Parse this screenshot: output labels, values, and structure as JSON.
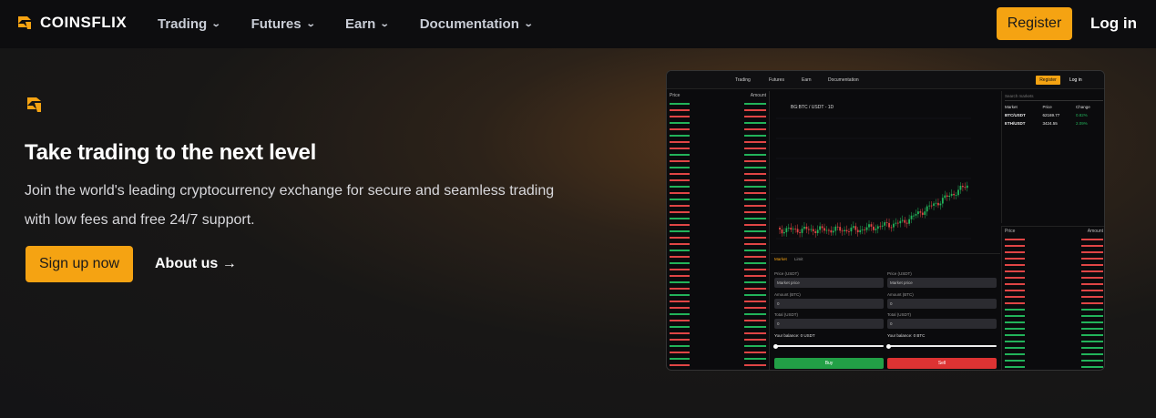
{
  "nav": {
    "brand": "COINSFLIX",
    "menu": [
      {
        "label": "Trading"
      },
      {
        "label": "Futures"
      },
      {
        "label": "Earn"
      },
      {
        "label": "Documentation"
      }
    ],
    "register_label": "Register",
    "login_label": "Log in"
  },
  "hero": {
    "title": "Take trading to the next level",
    "subtitle": "Join the world's leading cryptocurrency exchange for secure and seamless trading with low fees and free 24/7 support.",
    "signup_label": "Sign up now",
    "about_label": "About us →"
  },
  "preview": {
    "nav": [
      "Trading",
      "Futures",
      "Earn",
      "Documentation"
    ],
    "register": "Register",
    "login": "Log in",
    "orderbook_headers": [
      "Price",
      "Amount"
    ],
    "pair_title": "BG:BTC / USDT - 1D",
    "market_headers": [
      "Market",
      "Price",
      "Change"
    ],
    "markets": [
      {
        "m": "BTC/USDT",
        "p": "62169.77",
        "c": "0.82%"
      },
      {
        "m": "ETH/USDT",
        "p": "3424.55",
        "c": "2.09%"
      }
    ],
    "search_placeholder": "Search markets",
    "ticket_tabs": [
      "Market",
      "Limit"
    ],
    "price_label": "Price (USDT)",
    "price_value": "Market price",
    "amount_label": "Amount (BTC)",
    "amount_value": "0",
    "total_label": "Total (USDT)",
    "total_value": "0",
    "balance_left": "Your balance: 0 USDT",
    "balance_right": "Your balance: 0 BTC",
    "buy": "Buy",
    "sell": "Sell"
  },
  "colors": {
    "accent": "#f5a312",
    "up": "#22b35a",
    "down": "#e04545"
  }
}
